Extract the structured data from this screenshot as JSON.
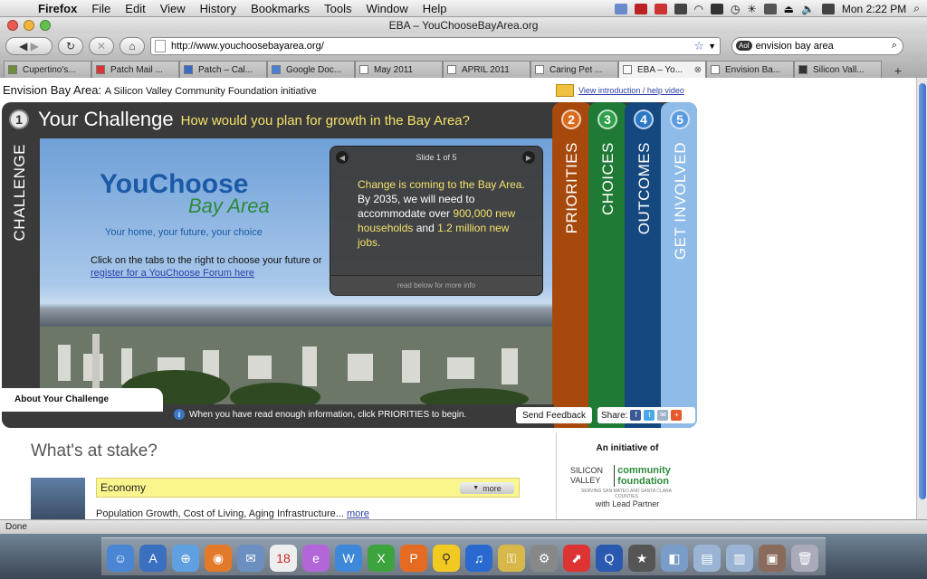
{
  "menubar": {
    "app": "Firefox",
    "items": [
      "File",
      "Edit",
      "View",
      "History",
      "Bookmarks",
      "Tools",
      "Window",
      "Help"
    ],
    "clock": "Mon 2:22 PM"
  },
  "window": {
    "title": "EBA – YouChooseBayArea.org"
  },
  "toolbar": {
    "url": "http://www.youchoosebayarea.org/",
    "search_value": "envision bay area",
    "search_engine": "Aol"
  },
  "tabs": [
    {
      "label": "Cupertino's...",
      "active": false
    },
    {
      "label": "Patch Mail ...",
      "active": false
    },
    {
      "label": "Patch – Cal...",
      "active": false
    },
    {
      "label": "Google Doc...",
      "active": false
    },
    {
      "label": "May 2011",
      "active": false
    },
    {
      "label": "APRIL 2011",
      "active": false
    },
    {
      "label": "Caring Pet ...",
      "active": false
    },
    {
      "label": "EBA – Yo...",
      "active": true
    },
    {
      "label": "Envision Ba...",
      "active": false
    },
    {
      "label": "Silicon Vall...",
      "active": false
    }
  ],
  "page": {
    "header_title": "Envision Bay Area:",
    "header_subtitle": "A Silicon Valley Community Foundation initiative",
    "intro_link": "View introduction / help video",
    "step": {
      "number": "1",
      "title": "Your Challenge",
      "question": "How would you plan for growth in the Bay Area?",
      "side_label": "CHALLENGE"
    },
    "logo": {
      "line1": "YouChoose",
      "line2": "Bay Area"
    },
    "tagline": "Your home, your future, your choice",
    "click_text": "Click on the tabs to the right to choose your future  or",
    "forum_link": "register for a YouChoose Forum here",
    "slide": {
      "counter": "Slide 1 of 5",
      "text_1": "Change is coming to the Bay Area.",
      "text_2": " By 2035, we will need to accommodate over ",
      "text_3": "900,000 new households",
      "text_4": " and ",
      "text_5": "1.2 million new jobs.",
      "footer": "read below for more info"
    },
    "side_tabs": [
      {
        "number": "2",
        "label": "PRIORITIES"
      },
      {
        "number": "3",
        "label": "CHOICES"
      },
      {
        "number": "4",
        "label": "OUTCOMES"
      },
      {
        "number": "5",
        "label": "GET INVOLVED"
      }
    ],
    "about_tab": "About Your Challenge",
    "info_message": "When you have read enough information, click PRIORITIES to begin.",
    "feedback_button": "Send Feedback",
    "share_label": "Share:",
    "stake_title": "What's at stake?",
    "economy": {
      "label": "Economy",
      "more": "more",
      "description": "Population Growth, Cost of Living, Aging Infrastructure...",
      "desc_link": "more"
    },
    "sidebar": {
      "initiative": "An initiative of",
      "svcf_left": "SILICON VALLEY",
      "svcf_right": "community foundation",
      "svcf_tiny": "SERVING SAN MATEO AND SANTA CLARA COUNTIES",
      "lead_partner": "with Lead Partner"
    }
  },
  "status": "Done",
  "colors": {
    "priorities": "#a7490d",
    "choices": "#1e7a34",
    "outcomes": "#15487f",
    "involved": "#8ebbe8",
    "accent_yellow": "#f4e26a"
  }
}
